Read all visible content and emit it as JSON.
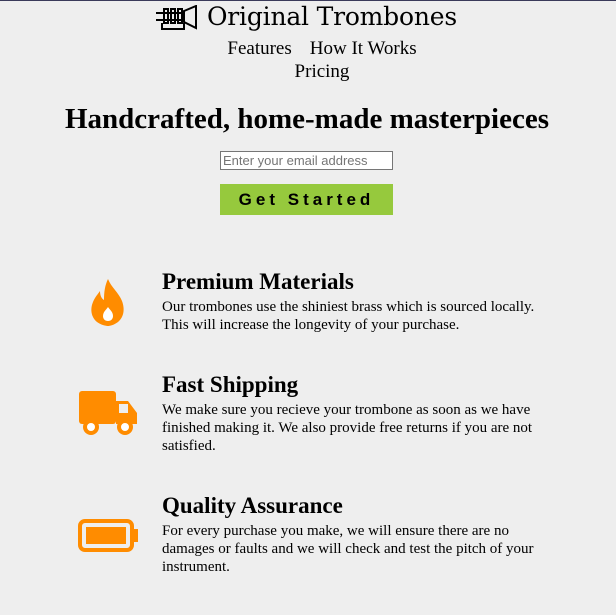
{
  "brand": {
    "name": "Original Trombones"
  },
  "nav": {
    "items": [
      "Features",
      "How It Works",
      "Pricing"
    ]
  },
  "hero": {
    "title": "Handcrafted, home-made masterpieces",
    "email_placeholder": "Enter your email address",
    "cta_label": "Get Started"
  },
  "features": [
    {
      "icon": "flame-icon",
      "title": "Premium Materials",
      "text": "Our trombones use the shiniest brass which is sourced locally. This will increase the longevity of your purchase."
    },
    {
      "icon": "truck-icon",
      "title": "Fast Shipping",
      "text": "We make sure you recieve your trombone as soon as we have finished making it. We also provide free returns if you are not satisfied."
    },
    {
      "icon": "battery-icon",
      "title": "Quality Assurance",
      "text": "For every purchase you make, we will ensure there are no damages or faults and we will check and test the pitch of your instrument."
    }
  ],
  "colors": {
    "background": "#eeeeee",
    "accent_button": "#96c93d",
    "icon_orange": "#ff8c00"
  }
}
